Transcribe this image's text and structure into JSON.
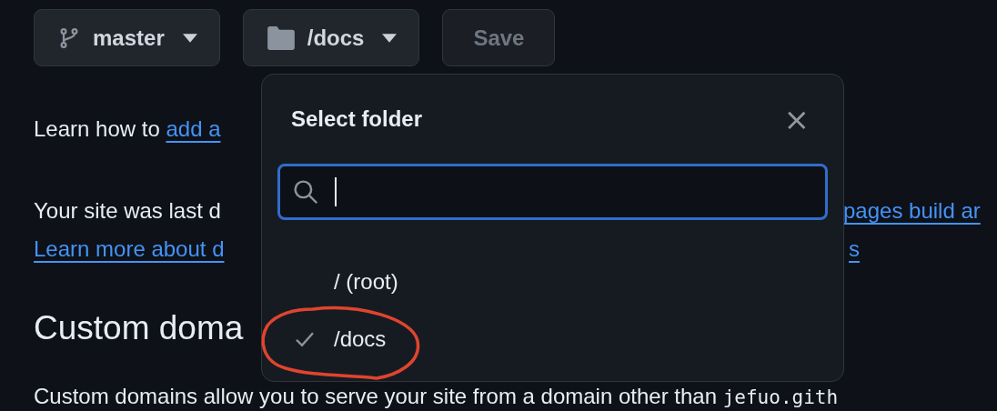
{
  "toolbar": {
    "branch_button": {
      "label": "master"
    },
    "folder_button": {
      "label": "/docs"
    },
    "save_button": {
      "label": "Save",
      "disabled": true
    }
  },
  "content": {
    "intro": {
      "text": "Learn how to ",
      "link": "add a"
    },
    "deploy_note": {
      "text": "Your site was last d",
      "link_right": "pages build ar"
    },
    "learn_more": {
      "link": "Learn more about d",
      "link_right": "s"
    },
    "heading": "Custom doma",
    "description": {
      "text": "Custom domains allow you to serve your site from a domain other than ",
      "code": "jefuo.gith"
    }
  },
  "dialog": {
    "title": "Select folder",
    "close": "×",
    "options": [
      {
        "label": "/ (root)",
        "selected": false
      },
      {
        "label": "/docs",
        "selected": true
      }
    ]
  }
}
